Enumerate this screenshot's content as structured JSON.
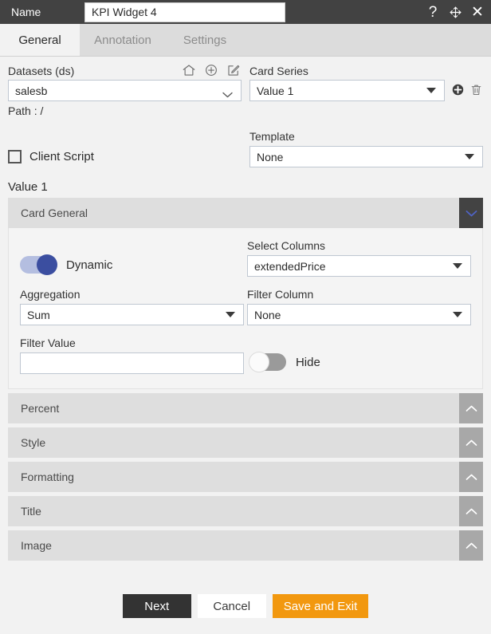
{
  "titlebar": {
    "name_label": "Name",
    "widget_name": "KPI Widget 4",
    "icons": {
      "help": "?",
      "move": "move-icon",
      "close": "✕"
    }
  },
  "tabs": [
    {
      "label": "General",
      "active": true
    },
    {
      "label": "Annotation",
      "active": false
    },
    {
      "label": "Settings",
      "active": false
    }
  ],
  "datasets": {
    "label": "Datasets (ds)",
    "value": "salesb",
    "path_label": "Path :",
    "path_value": "/",
    "icons": [
      "home-icon",
      "add-circle-icon",
      "edit-icon"
    ]
  },
  "card_series": {
    "label": "Card Series",
    "value": "Value 1",
    "icons": [
      "add-series-icon",
      "delete-series-icon"
    ]
  },
  "client_script": {
    "label": "Client Script",
    "checked": false
  },
  "template": {
    "label": "Template",
    "value": "None"
  },
  "value_heading": "Value 1",
  "card_general": {
    "title": "Card General",
    "expanded": true,
    "dynamic": {
      "label": "Dynamic",
      "on": true
    },
    "select_columns": {
      "label": "Select Columns",
      "value": "extendedPrice"
    },
    "aggregation": {
      "label": "Aggregation",
      "value": "Sum"
    },
    "filter_column": {
      "label": "Filter Column",
      "value": "None"
    },
    "filter_value": {
      "label": "Filter Value",
      "value": "",
      "placeholder": ""
    },
    "hide": {
      "label": "Hide",
      "on": false
    }
  },
  "sections": [
    {
      "title": "Percent"
    },
    {
      "title": "Style"
    },
    {
      "title": "Formatting"
    },
    {
      "title": "Title"
    },
    {
      "title": "Image"
    }
  ],
  "footer": {
    "next": "Next",
    "cancel": "Cancel",
    "save": "Save and Exit"
  },
  "colors": {
    "accent_orange": "#f2980f",
    "toggle_on": "#3b4ea0",
    "titlebar": "#424242",
    "section_header": "#dedede"
  }
}
